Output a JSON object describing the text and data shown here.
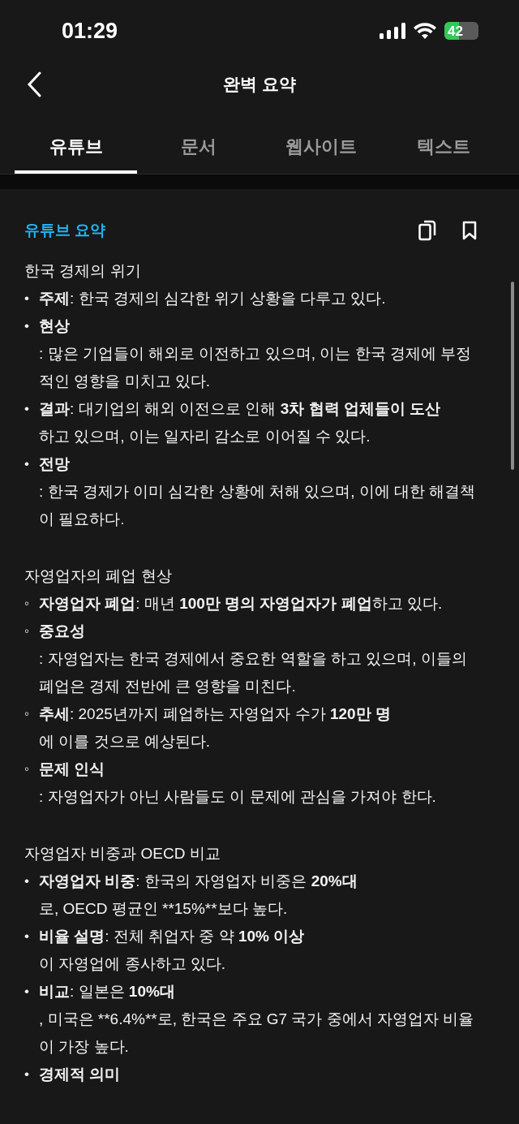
{
  "status_bar": {
    "time": "01:29",
    "battery": "42"
  },
  "header": {
    "title": "완벽 요약"
  },
  "tabs": [
    {
      "label": "유튜브",
      "selected": true
    },
    {
      "label": "문서",
      "selected": false
    },
    {
      "label": "웹사이트",
      "selected": false
    },
    {
      "label": "텍스트",
      "selected": false
    }
  ],
  "summary": {
    "heading": "유튜브 요약",
    "sections": [
      {
        "title": "한국 경제의 위기",
        "bullet": "•",
        "items": [
          {
            "lines": [
              [
                {
                  "text": "주제",
                  "bold": true
                },
                {
                  "text": ": 한국 경제의 심각한 위기 상황을 다루고 있다.",
                  "bold": false
                }
              ]
            ]
          },
          {
            "lines": [
              [
                {
                  "text": "현상",
                  "bold": true
                }
              ],
              [
                {
                  "text": ": 많은 기업들이 해외로 이전하고 있으며, 이는 한국 경제에 부정적인 영향을 미치고 있다.",
                  "bold": false
                }
              ]
            ]
          },
          {
            "lines": [
              [
                {
                  "text": "결과",
                  "bold": true
                },
                {
                  "text": ": 대기업의 해외 이전으로 인해 ",
                  "bold": false
                },
                {
                  "text": "3차 협력 업체들이 도산",
                  "bold": true
                }
              ],
              [
                {
                  "text": "하고 있으며, 이는 일자리 감소로 이어질 수 있다.",
                  "bold": false
                }
              ]
            ]
          },
          {
            "lines": [
              [
                {
                  "text": "전망",
                  "bold": true
                }
              ],
              [
                {
                  "text": ": 한국 경제가 이미 심각한 상황에 처해 있으며, 이에 대한 해결책이 필요하다.",
                  "bold": false
                }
              ]
            ]
          }
        ]
      },
      {
        "title": "자영업자의 폐업 현상",
        "bullet": "◦",
        "items": [
          {
            "lines": [
              [
                {
                  "text": "자영업자 폐업",
                  "bold": true
                },
                {
                  "text": ": 매년 ",
                  "bold": false
                },
                {
                  "text": "100만 명의 자영업자가 폐업",
                  "bold": true
                },
                {
                  "text": "하고 있다.",
                  "bold": false
                }
              ]
            ]
          },
          {
            "lines": [
              [
                {
                  "text": "중요성",
                  "bold": true
                }
              ],
              [
                {
                  "text": ": 자영업자는 한국 경제에서 중요한 역할을 하고 있으며, 이들의 폐업은 경제 전반에 큰 영향을 미친다.",
                  "bold": false
                }
              ]
            ]
          },
          {
            "lines": [
              [
                {
                  "text": "추세",
                  "bold": true
                },
                {
                  "text": ": 2025년까지 폐업하는 자영업자 수가 ",
                  "bold": false
                },
                {
                  "text": "120만 명",
                  "bold": true
                }
              ],
              [
                {
                  "text": "에 이를 것으로 예상된다.",
                  "bold": false
                }
              ]
            ]
          },
          {
            "lines": [
              [
                {
                  "text": "문제 인식",
                  "bold": true
                }
              ],
              [
                {
                  "text": ": 자영업자가 아닌 사람들도 이 문제에 관심을 가져야 한다.",
                  "bold": false
                }
              ]
            ]
          }
        ]
      },
      {
        "title": "자영업자 비중과 OECD 비교",
        "bullet": "•",
        "items": [
          {
            "lines": [
              [
                {
                  "text": "자영업자 비중",
                  "bold": true
                },
                {
                  "text": ": 한국의 자영업자 비중은 ",
                  "bold": false
                },
                {
                  "text": "20%대",
                  "bold": true
                }
              ],
              [
                {
                  "text": "로, OECD 평균인 **15%**보다 높다.",
                  "bold": false
                }
              ]
            ]
          },
          {
            "lines": [
              [
                {
                  "text": "비율 설명",
                  "bold": true
                },
                {
                  "text": ": 전체 취업자 중 약 ",
                  "bold": false
                },
                {
                  "text": "10% 이상",
                  "bold": true
                }
              ],
              [
                {
                  "text": "이 자영업에 종사하고 있다.",
                  "bold": false
                }
              ]
            ]
          },
          {
            "lines": [
              [
                {
                  "text": "비교",
                  "bold": true
                },
                {
                  "text": ": 일본은 ",
                  "bold": false
                },
                {
                  "text": "10%대",
                  "bold": true
                }
              ],
              [
                {
                  "text": ", 미국은 **6.4%**로, 한국은 주요 G7 국가 중에서 자영업자 비율이 가장 높다.",
                  "bold": false
                }
              ]
            ]
          },
          {
            "lines": [
              [
                {
                  "text": "경제적 의미",
                  "bold": true
                }
              ]
            ]
          }
        ]
      }
    ]
  }
}
